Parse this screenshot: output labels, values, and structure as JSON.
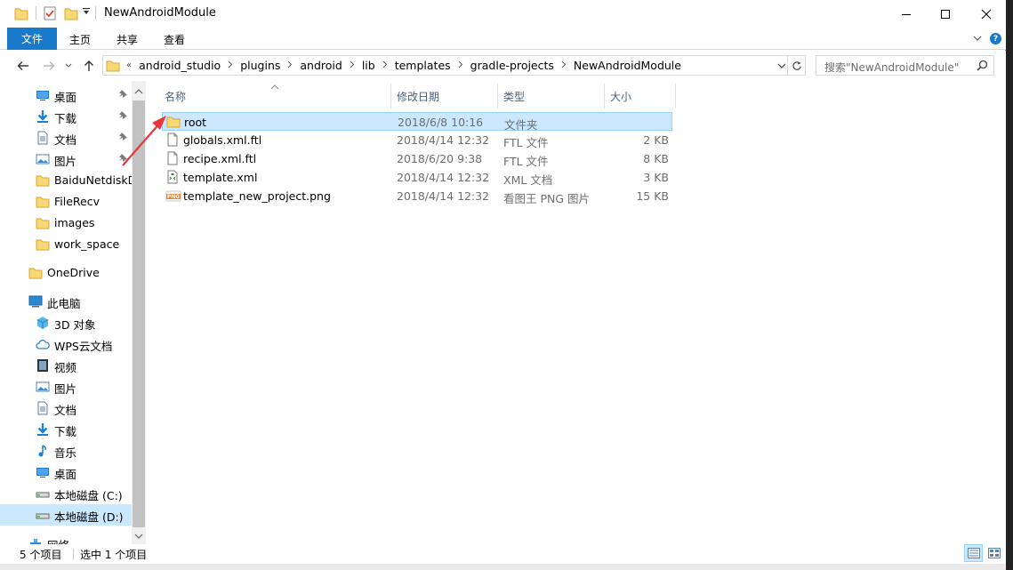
{
  "window": {
    "title": "NewAndroidModule"
  },
  "ribbon": {
    "tabs": [
      "文件",
      "主页",
      "共享",
      "查看"
    ]
  },
  "address": {
    "prefix": "«",
    "crumbs": [
      "android_studio",
      "plugins",
      "android",
      "lib",
      "templates",
      "gradle-projects",
      "NewAndroidModule"
    ]
  },
  "search": {
    "placeholder": "搜索\"NewAndroidModule\""
  },
  "sidebar": {
    "items": [
      {
        "label": "桌面",
        "icon": "desktop-icon",
        "pinned": true
      },
      {
        "label": "下载",
        "icon": "download-icon",
        "pinned": true
      },
      {
        "label": "文档",
        "icon": "document-icon",
        "pinned": true
      },
      {
        "label": "图片",
        "icon": "pictures-icon",
        "pinned": true
      },
      {
        "label": "BaiduNetdiskD",
        "icon": "folder-icon",
        "pinned": false
      },
      {
        "label": "FileRecv",
        "icon": "folder-icon",
        "pinned": false
      },
      {
        "label": "images",
        "icon": "folder-icon",
        "pinned": false
      },
      {
        "label": "work_space",
        "icon": "folder-icon",
        "pinned": false
      },
      {
        "label": "OneDrive",
        "icon": "folder-icon",
        "pinned": false
      },
      {
        "label": "此电脑",
        "icon": "computer-icon",
        "pinned": false
      },
      {
        "label": "3D 对象",
        "icon": "3d-objects-icon",
        "pinned": false
      },
      {
        "label": "WPS云文档",
        "icon": "cloud-icon",
        "pinned": false
      },
      {
        "label": "视频",
        "icon": "video-icon",
        "pinned": false
      },
      {
        "label": "图片",
        "icon": "pictures-icon",
        "pinned": false
      },
      {
        "label": "文档",
        "icon": "document-icon",
        "pinned": false
      },
      {
        "label": "下载",
        "icon": "download-icon",
        "pinned": false
      },
      {
        "label": "音乐",
        "icon": "music-icon",
        "pinned": false
      },
      {
        "label": "桌面",
        "icon": "desktop-icon",
        "pinned": false
      },
      {
        "label": "本地磁盘 (C:)",
        "icon": "drive-icon",
        "pinned": false
      },
      {
        "label": "本地磁盘 (D:)",
        "icon": "drive-icon",
        "pinned": false
      },
      {
        "label": "网络",
        "icon": "network-icon",
        "pinned": false
      }
    ]
  },
  "columns": {
    "name": "名称",
    "date": "修改日期",
    "type": "类型",
    "size": "大小"
  },
  "files": [
    {
      "name": "root",
      "date": "2018/6/8 10:16",
      "type": "文件夹",
      "size": "",
      "icon": "folder-icon",
      "selected": true
    },
    {
      "name": "globals.xml.ftl",
      "date": "2018/4/14 12:32",
      "type": "FTL 文件",
      "size": "2 KB",
      "icon": "file-icon",
      "selected": false
    },
    {
      "name": "recipe.xml.ftl",
      "date": "2018/6/20 9:38",
      "type": "FTL 文件",
      "size": "8 KB",
      "icon": "file-icon",
      "selected": false
    },
    {
      "name": "template.xml",
      "date": "2018/4/14 12:32",
      "type": "XML 文档",
      "size": "3 KB",
      "icon": "xml-file-icon",
      "selected": false
    },
    {
      "name": "template_new_project.png",
      "date": "2018/4/14 12:32",
      "type": "看图王 PNG 图片",
      "size": "15 KB",
      "icon": "png-file-icon",
      "selected": false
    }
  ],
  "status": {
    "count": "5 个项目",
    "selection": "选中 1 个项目"
  },
  "colors": {
    "accent": "#1979ca",
    "selection": "#cce8ff",
    "folder": "#f8d775",
    "annotation_arrow": "#e8383d"
  }
}
